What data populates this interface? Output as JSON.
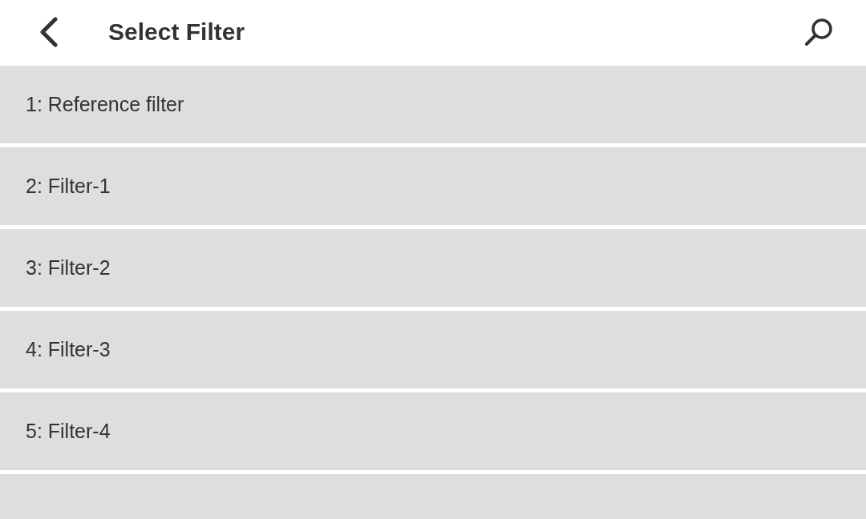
{
  "header": {
    "title": "Select Filter"
  },
  "filters": [
    {
      "label": "1: Reference filter"
    },
    {
      "label": "2: Filter-1"
    },
    {
      "label": "3: Filter-2"
    },
    {
      "label": "4: Filter-3"
    },
    {
      "label": "5: Filter-4"
    }
  ]
}
